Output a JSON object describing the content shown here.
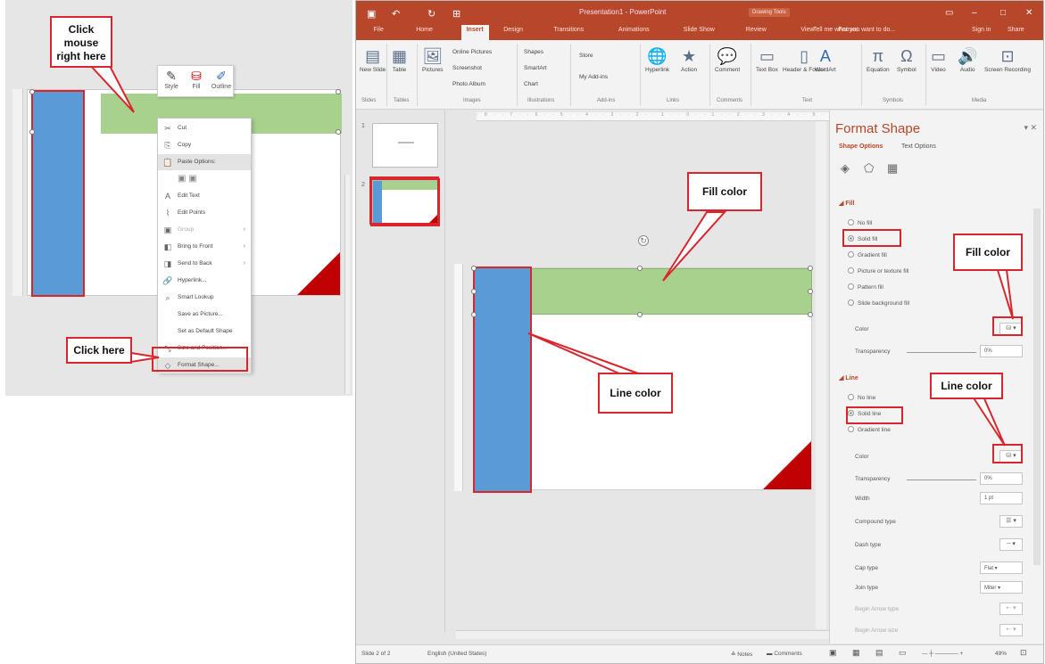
{
  "left_panel": {
    "mini_toolbar": {
      "style": "Style",
      "fill": "Fill",
      "outline": "Outline"
    },
    "menu": [
      {
        "label": "Cut",
        "icon": "✂",
        "icon_name": "cut-icon"
      },
      {
        "label": "Copy",
        "icon": "⎘",
        "icon_name": "copy-icon"
      },
      {
        "label": "Paste Options:",
        "icon": "📋",
        "icon_name": "paste-icon",
        "highlighted": true
      },
      {
        "label": "",
        "icon": "",
        "icon_name": "paste-options-icon"
      },
      {
        "label": "Edit Text",
        "icon": "A",
        "icon_name": "edit-text-icon"
      },
      {
        "label": "Edit Points",
        "icon": "⌇",
        "icon_name": "edit-points-icon"
      },
      {
        "label": "Group",
        "icon": "▣",
        "icon_name": "group-icon",
        "dim": true,
        "arrow": "›"
      },
      {
        "label": "Bring to Front",
        "icon": "◧",
        "icon_name": "bring-to-front-icon",
        "arrow": "›"
      },
      {
        "label": "Send to Back",
        "icon": "◨",
        "icon_name": "send-to-back-icon",
        "arrow": "›"
      },
      {
        "label": "Hyperlink...",
        "icon": "🔗",
        "icon_name": "hyperlink-icon"
      },
      {
        "label": "Smart Lookup",
        "icon": "⌕",
        "icon_name": "smart-lookup-icon"
      },
      {
        "label": "Save as Picture...",
        "icon": "",
        "icon_name": ""
      },
      {
        "label": "Set as Default Shape",
        "icon": "",
        "icon_name": ""
      },
      {
        "label": "Size and Position...",
        "icon": "⤡",
        "icon_name": "size-position-icon"
      },
      {
        "label": "Format Shape...",
        "icon": "◇",
        "icon_name": "format-shape-icon",
        "highlighted": true
      }
    ]
  },
  "callouts": {
    "click_mouse": "Click mouse right here",
    "click_here": "Click here",
    "fill_color_slide": "Fill color",
    "line_color_slide": "Line color",
    "fill_color_pane": "Fill color",
    "line_color_pane": "Line color"
  },
  "ppt": {
    "title": "Presentation1 - PowerPoint",
    "context_tab": "Drawing Tools",
    "tell_me": "Tell me what you want to do...",
    "sign_in": "Sign in",
    "share": "Share",
    "tabs": [
      "File",
      "Home",
      "Insert",
      "Design",
      "Transitions",
      "Animations",
      "Slide Show",
      "Review",
      "View",
      "Format"
    ],
    "active_tab": "Insert",
    "ribbon": {
      "new_slide": "New Slide",
      "table": "Table",
      "pictures": "Pictures",
      "online_pictures": "Online Pictures",
      "screenshot": "Screenshot",
      "photo_album": "Photo Album",
      "shapes": "Shapes",
      "smartart": "SmartArt",
      "chart": "Chart",
      "store": "Store",
      "my_addins": "My Add-ins",
      "hyperlink": "Hyperlink",
      "action": "Action",
      "comment": "Comment",
      "text_box": "Text Box",
      "header_footer": "Header & Footer",
      "wordart": "WordArt",
      "equation": "Equation",
      "symbol": "Symbol",
      "video": "Video",
      "audio": "Audio",
      "screen_recording": "Screen Recording",
      "groups": [
        "Slides",
        "Tables",
        "Images",
        "Illustrations",
        "Add-ins",
        "Links",
        "Comments",
        "Text",
        "Symbols",
        "Media"
      ]
    },
    "thumb_numbers": [
      "1",
      "2"
    ],
    "status": {
      "slide": "Slide 2 of 2",
      "language": "English (United States)",
      "notes": "Notes",
      "comments": "Comments",
      "zoom": "49%"
    }
  },
  "pane": {
    "title": "Format Shape",
    "tab_shape": "Shape Options",
    "tab_text": "Text Options",
    "fill_header": "Fill",
    "fill_options": [
      "No fill",
      "Solid fill",
      "Gradient fill",
      "Picture or texture fill",
      "Pattern fill",
      "Slide background fill"
    ],
    "fill_selected": 1,
    "color_label": "Color",
    "transparency_label": "Transparency",
    "fill_transparency": "0%",
    "line_header": "Line",
    "line_options": [
      "No line",
      "Solid line",
      "Gradient line"
    ],
    "line_selected": 1,
    "line_transparency": "0%",
    "width_label": "Width",
    "width_value": "1 pt",
    "compound_label": "Compound type",
    "dash_label": "Dash type",
    "cap_label": "Cap type",
    "cap_value": "Flat",
    "join_label": "Join type",
    "join_value": "Miter",
    "begin_arrow_label": "Begin Arrow type",
    "begin_arrow_size": "Begin Arrow size"
  },
  "colors": {
    "accent": "#b7472a",
    "highlight": "#d9262c",
    "green": "#a9d18e",
    "blue": "#5b9bd5",
    "red_triangle": "#c00000"
  }
}
